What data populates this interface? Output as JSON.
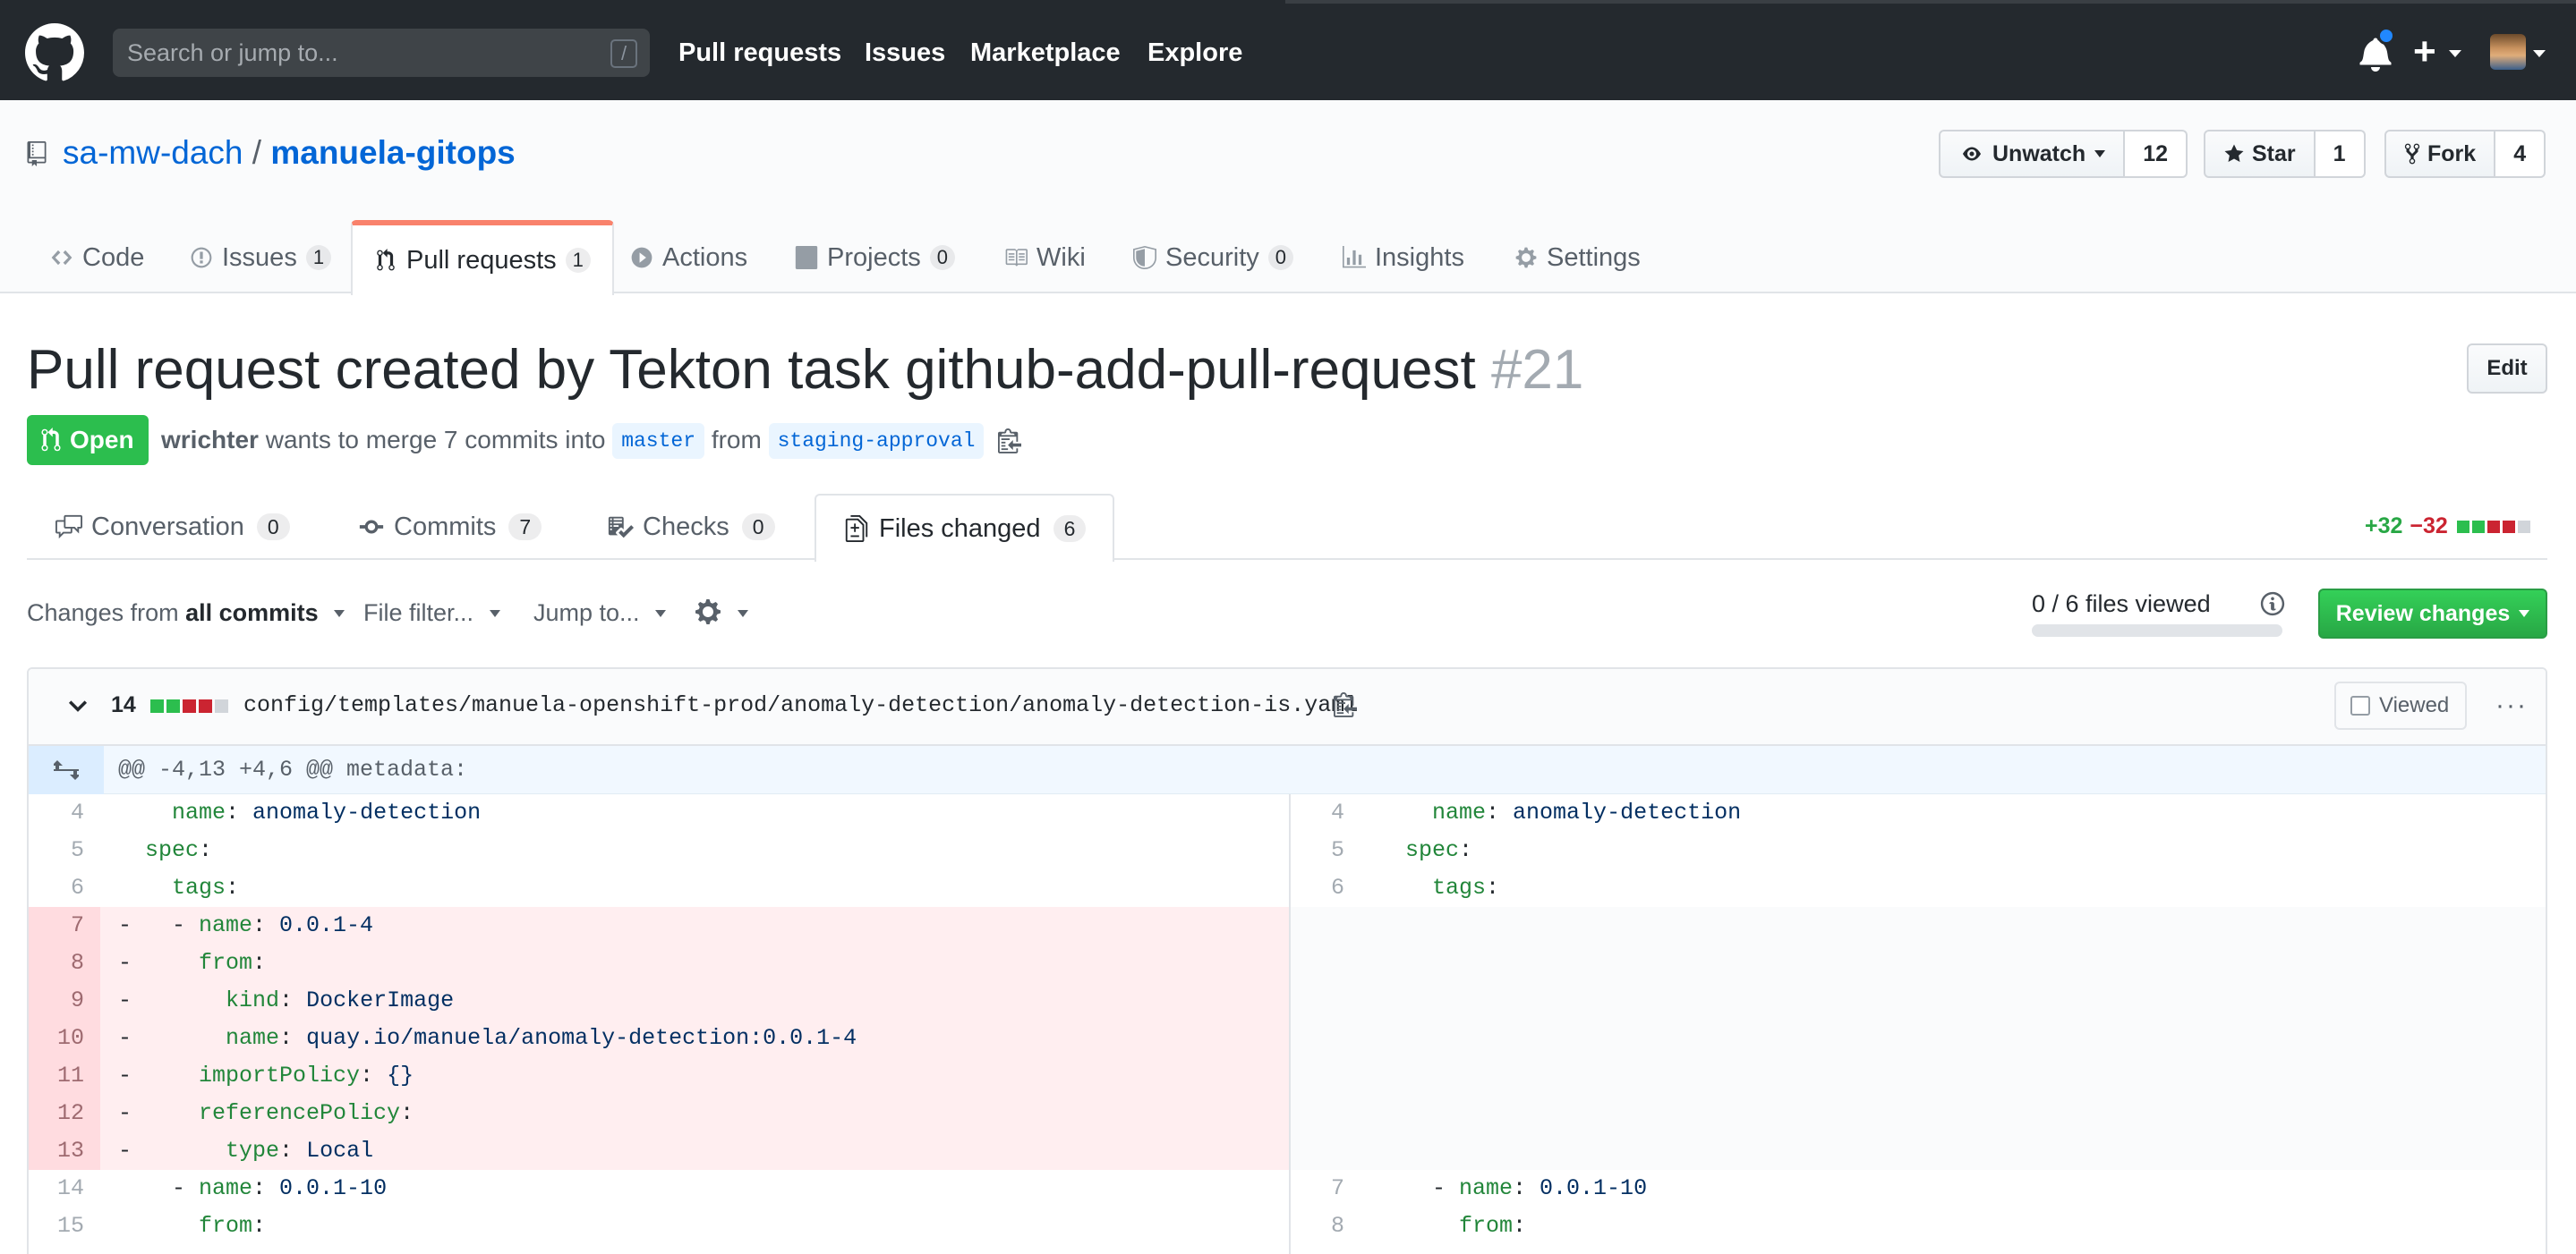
{
  "header": {
    "search_placeholder": "Search or jump to...",
    "search_shortcut": "/",
    "nav": [
      "Pull requests",
      "Issues",
      "Marketplace",
      "Explore"
    ],
    "plus_label": "+"
  },
  "repo": {
    "owner": "sa-mw-dach",
    "separator": "/",
    "name": "manuela-gitops",
    "watch_label": "Unwatch",
    "watch_count": "12",
    "star_label": "Star",
    "star_count": "1",
    "fork_label": "Fork",
    "fork_count": "4",
    "tabs": [
      {
        "label": "Code",
        "icon": "code-icon"
      },
      {
        "label": "Issues",
        "count": "1",
        "icon": "issue-icon"
      },
      {
        "label": "Pull requests",
        "count": "1",
        "icon": "pull-request-icon"
      },
      {
        "label": "Actions",
        "icon": "play-icon"
      },
      {
        "label": "Projects",
        "count": "0",
        "icon": "project-icon"
      },
      {
        "label": "Wiki",
        "icon": "book-icon"
      },
      {
        "label": "Security",
        "count": "0",
        "icon": "shield-icon"
      },
      {
        "label": "Insights",
        "icon": "graph-icon"
      },
      {
        "label": "Settings",
        "icon": "gear-icon"
      }
    ]
  },
  "pr": {
    "title": "Pull request created by Tekton task github-add-pull-request",
    "number": "#21",
    "edit_label": "Edit",
    "state": "Open",
    "author": "wrichter",
    "merge_text": "wants to merge 7 commits into",
    "base_branch": "master",
    "from_text": "from",
    "head_branch": "staging-approval",
    "tabs": [
      {
        "label": "Conversation",
        "count": "0",
        "icon": "comment-icon"
      },
      {
        "label": "Commits",
        "count": "7",
        "icon": "commit-icon"
      },
      {
        "label": "Checks",
        "count": "0",
        "icon": "checklist-icon"
      },
      {
        "label": "Files changed",
        "count": "6",
        "icon": "file-diff-icon"
      }
    ],
    "additions": "+32",
    "deletions": "−32"
  },
  "toolbar": {
    "changes_from": "Changes from",
    "all_commits": "all commits",
    "file_filter": "File filter...",
    "jump_to": "Jump to...",
    "files_viewed": "0 / 6 files viewed",
    "files_viewed_progress": 0,
    "review_label": "Review changes"
  },
  "file": {
    "changes": "14",
    "path": "config/templates/manuela-openshift-prod/anomaly-detection/anomaly-detection-is.yaml",
    "viewed_label": "Viewed",
    "more": "···",
    "hunk": "@@ -4,13 +4,6 @@ metadata:"
  },
  "diff_rows": [
    {
      "l_num": "4",
      "l_code": [
        [
          "",
          "    "
        ],
        [
          "k",
          "name"
        ],
        [
          "p",
          ": "
        ],
        [
          "v",
          "anomaly-detection"
        ]
      ],
      "r_num": "4",
      "r_code": [
        [
          "",
          "    "
        ],
        [
          "k",
          "name"
        ],
        [
          "p",
          ": "
        ],
        [
          "v",
          "anomaly-detection"
        ]
      ]
    },
    {
      "l_num": "5",
      "l_code": [
        [
          "",
          "  "
        ],
        [
          "k",
          "spec"
        ],
        [
          "p",
          ":"
        ]
      ],
      "r_num": "5",
      "r_code": [
        [
          "",
          "  "
        ],
        [
          "k",
          "spec"
        ],
        [
          "p",
          ":"
        ]
      ]
    },
    {
      "l_num": "6",
      "l_code": [
        [
          "",
          "    "
        ],
        [
          "k",
          "tags"
        ],
        [
          "p",
          ":"
        ]
      ],
      "r_num": "6",
      "r_code": [
        [
          "",
          "    "
        ],
        [
          "k",
          "tags"
        ],
        [
          "p",
          ":"
        ]
      ]
    },
    {
      "l_num": "7",
      "del": true,
      "l_code": [
        [
          "p",
          "-   - "
        ],
        [
          "k",
          "name"
        ],
        [
          "p",
          ": "
        ],
        [
          "v",
          "0.0.1-4"
        ]
      ]
    },
    {
      "l_num": "8",
      "del": true,
      "l_code": [
        [
          "p",
          "-     "
        ],
        [
          "k",
          "from"
        ],
        [
          "p",
          ":"
        ]
      ]
    },
    {
      "l_num": "9",
      "del": true,
      "l_code": [
        [
          "p",
          "-       "
        ],
        [
          "k",
          "kind"
        ],
        [
          "p",
          ": "
        ],
        [
          "v",
          "DockerImage"
        ]
      ]
    },
    {
      "l_num": "10",
      "del": true,
      "l_code": [
        [
          "p",
          "-       "
        ],
        [
          "k",
          "name"
        ],
        [
          "p",
          ": "
        ],
        [
          "v",
          "quay.io/manuela/anomaly-detection:0.0.1-4"
        ]
      ]
    },
    {
      "l_num": "11",
      "del": true,
      "l_code": [
        [
          "p",
          "-     "
        ],
        [
          "k",
          "importPolicy"
        ],
        [
          "p",
          ": "
        ],
        [
          "v",
          "{}"
        ]
      ]
    },
    {
      "l_num": "12",
      "del": true,
      "l_code": [
        [
          "p",
          "-     "
        ],
        [
          "k",
          "referencePolicy"
        ],
        [
          "p",
          ":"
        ]
      ]
    },
    {
      "l_num": "13",
      "del": true,
      "l_code": [
        [
          "p",
          "-       "
        ],
        [
          "k",
          "type"
        ],
        [
          "p",
          ": "
        ],
        [
          "v",
          "Local"
        ]
      ]
    },
    {
      "l_num": "14",
      "l_code": [
        [
          "",
          "    - "
        ],
        [
          "k",
          "name"
        ],
        [
          "p",
          ": "
        ],
        [
          "v",
          "0.0.1-10"
        ]
      ],
      "r_num": "7",
      "r_code": [
        [
          "",
          "    - "
        ],
        [
          "k",
          "name"
        ],
        [
          "p",
          ": "
        ],
        [
          "v",
          "0.0.1-10"
        ]
      ]
    },
    {
      "l_num": "15",
      "l_code": [
        [
          "",
          "      "
        ],
        [
          "k",
          "from"
        ],
        [
          "p",
          ":"
        ]
      ],
      "r_num": "8",
      "r_code": [
        [
          "",
          "      "
        ],
        [
          "k",
          "from"
        ],
        [
          "p",
          ":"
        ]
      ]
    }
  ]
}
